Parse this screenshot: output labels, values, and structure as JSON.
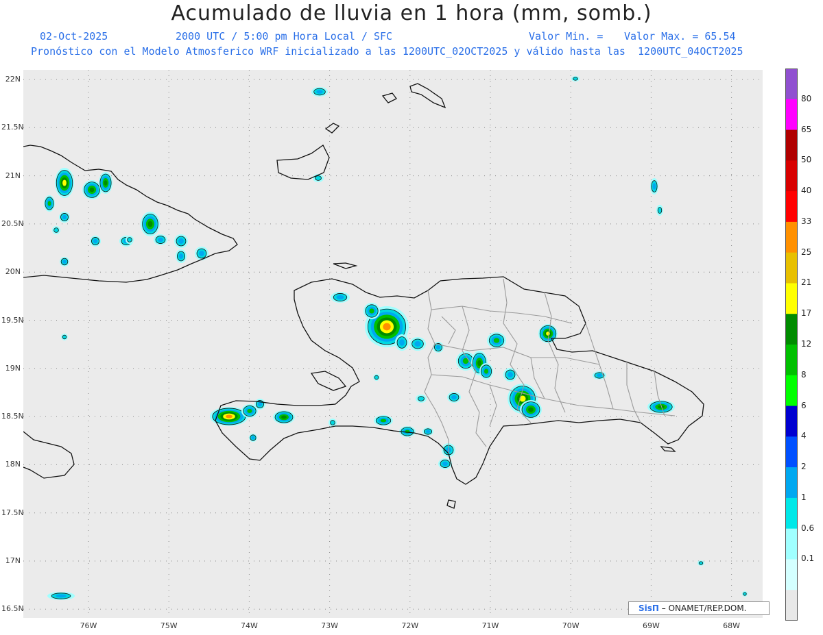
{
  "header": {
    "title": "Acumulado de lluvia en 1 hora (mm, somb.)",
    "date": "02-Oct-2025",
    "time_info": "2000 UTC / 5:00 pm Hora Local / SFC",
    "min_label": "Valor Min. =",
    "max_label": "Valor Max. = 65.54",
    "model_info": "Pronóstico con el Modelo Atmosferico WRF inicializado a las 1200UTC_02OCT2025 y válido hasta las  1200UTC_04OCT2025"
  },
  "axes": {
    "lat_labels": [
      "22N",
      "21.5N",
      "21N",
      "20.5N",
      "20N",
      "19.5N",
      "19N",
      "18.5N",
      "18N",
      "17.5N",
      "17N",
      "16.5N"
    ],
    "lon_labels": [
      "76W",
      "75W",
      "74W",
      "73W",
      "72W",
      "71W",
      "70W",
      "69W",
      "68W"
    ]
  },
  "colorbar": {
    "labels": [
      "0.1",
      "0.6",
      "1",
      "2",
      "4",
      "6",
      "8",
      "12",
      "17",
      "21",
      "25",
      "33",
      "40",
      "50",
      "65",
      "80"
    ],
    "colors": [
      "#e8e8e8",
      "#d4ffff",
      "#a0ffff",
      "#00e8e8",
      "#00a8f0",
      "#0050ff",
      "#0000d0",
      "#00ff00",
      "#00c000",
      "#008c00",
      "#ffff00",
      "#e8c000",
      "#ff9000",
      "#ff0000",
      "#d80000",
      "#b00000",
      "#ff00ff",
      "#9050d0"
    ]
  },
  "credit": {
    "brand": "SisΠ",
    "text": "– ONAMET/REP.DOM."
  }
}
